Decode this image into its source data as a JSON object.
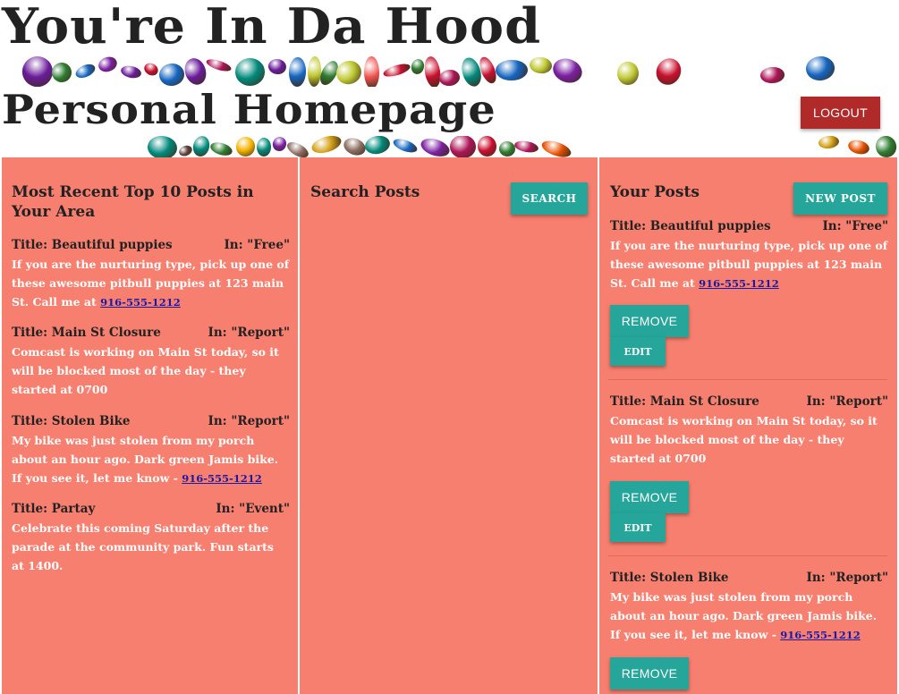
{
  "header": {
    "title": "You're In Da Hood",
    "subtitle": "Personal Homepage",
    "logout_label": "LOGOUT"
  },
  "columns": {
    "top_posts": {
      "heading": "Most Recent Top 10 Posts in Your Area",
      "posts": [
        {
          "title": "Title: Beautiful puppies",
          "category": "In: \"Free\"",
          "body": "If you are the nurturing type, pick up one of these awesome pitbull puppies at 123 main St. Call me at ",
          "phone": "916-555-1212"
        },
        {
          "title": "Title: Main St Closure",
          "category": "In: \"Report\"",
          "body": "Comcast is working on Main St today, so it will be blocked most of the day - they started at 0700",
          "phone": ""
        },
        {
          "title": "Title: Stolen Bike",
          "category": "In: \"Report\"",
          "body": "My bike was just stolen from my porch about an hour ago. Dark green Jamis bike. If you see it, let me know - ",
          "phone": "916-555-1212"
        },
        {
          "title": "Title: Partay",
          "category": "In: \"Event\"",
          "body": "Celebrate this coming Saturday after the parade at the community park. Fun starts at 1400.",
          "phone": ""
        }
      ]
    },
    "search": {
      "heading": "Search Posts",
      "search_label": "SEARCH"
    },
    "your_posts": {
      "heading": "Your Posts",
      "new_post_label": "NEW POST",
      "remove_label": "REMOVE",
      "edit_label": "EDIT",
      "posts": [
        {
          "title": "Title: Beautiful puppies",
          "category": "In: \"Free\"",
          "body": "If you are the nurturing type, pick up one of these awesome pitbull puppies at 123 main St. Call me at ",
          "phone": "916-555-1212"
        },
        {
          "title": "Title: Main St Closure",
          "category": "In: \"Report\"",
          "body": "Comcast is working on Main St today, so it will be blocked most of the day - they started at 0700",
          "phone": ""
        },
        {
          "title": "Title: Stolen Bike",
          "category": "In: \"Report\"",
          "body": "My bike was just stolen from my porch about an hour ago. Dark green Jamis bike. If you see it, let me know - ",
          "phone": "916-555-1212"
        }
      ]
    }
  },
  "colors": {
    "panel": "#f77f6f",
    "teal": "#26a69a",
    "logout": "#b02a2a",
    "link": "#1a1aa6"
  }
}
